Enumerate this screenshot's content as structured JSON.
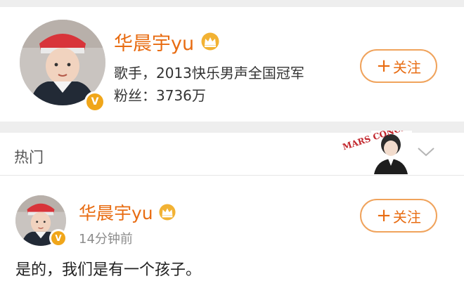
{
  "profile": {
    "name": "华晨宇yu",
    "bio": "歌手，2013快乐男声全国冠军",
    "fans": "粉丝：3736万",
    "follow_plus": "+",
    "follow_label": "关注",
    "verified_mark": "V"
  },
  "section": {
    "label": "热门",
    "sticker_text": "MARS CONCERT"
  },
  "post": {
    "author": "华晨宇yu",
    "time": "14分钟前",
    "follow_plus": "+",
    "follow_label": "关注",
    "verified_mark": "V",
    "text": "是的，我们是有一个孩子。"
  },
  "colors": {
    "accent": "#e86c12",
    "badge": "#f0a61a",
    "divider": "#eeeeee"
  }
}
